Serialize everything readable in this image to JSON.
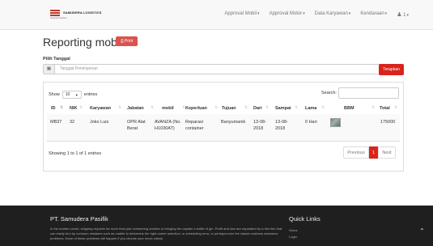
{
  "navbar": {
    "logo_text": "SAMUDERA LOGISTICS",
    "logo_tagline": "Integrated logistics",
    "items": [
      {
        "label": "Approval Mobil"
      },
      {
        "label": "Approval Motor"
      },
      {
        "label": "Data Karyawan"
      },
      {
        "label": "Kendaraan"
      },
      {
        "label": "1"
      }
    ],
    "user_icon": "user-icon"
  },
  "page": {
    "title": "Reporting mobil",
    "print_label": "Print",
    "print_icon": "printer-icon"
  },
  "filter": {
    "label": "Pilih Tanggal",
    "calendar_icon": "calendar-icon",
    "placeholder": "Tanggal Peminjaman",
    "apply_label": "Terapkan"
  },
  "table": {
    "show_label": "Show",
    "entries_value": "10",
    "entries_label": "entries",
    "search_label": "Search:",
    "columns": [
      "ID",
      "NIK",
      "Karyawan",
      "Jabatan",
      "mobil",
      "Keperluan",
      "Tujuan",
      "Dari",
      "Sampai",
      "Lama",
      "BBM",
      "Total"
    ],
    "rows": [
      {
        "id": "MB37",
        "nik": "32",
        "karyawan": "Joko Luis",
        "jabatan": "OPR Alat Berat",
        "mobil": "AVANZA (No. H1030AT)",
        "keperluan": "Reparasi container",
        "tujuan": "Banyumanik",
        "dari": "13-08-2018",
        "sampai": "13-08-2018",
        "lama": "0 Hari",
        "bbm": "receipt-image",
        "total": "175000"
      }
    ],
    "info": "Showing 1 to 1 of 1 entries",
    "pagination": {
      "previous": "Previous",
      "current": "1",
      "next": "Next"
    }
  },
  "footer": {
    "company": "PT. Samudera Pasifik",
    "description": "In the modern world, shipping requires far more than just overseeing cookies or bringing the captain a bottle of gin. Profit and loss are separated by a thin line that can easily turn by common mistakes such as unable to determine the right carrier selection, or scheduling error, or perhaps even the classic customs clearance problems. None of these problems will happen if you choose your move wisely.",
    "quick_links_title": "Quick Links",
    "links": [
      "Home",
      "Login"
    ],
    "scroll_top_icon": "chevron-up-icon"
  },
  "colors": {
    "brand_red": "#d9241d",
    "print_red": "#d9534f",
    "footer_bg": "#1f1f1f"
  }
}
